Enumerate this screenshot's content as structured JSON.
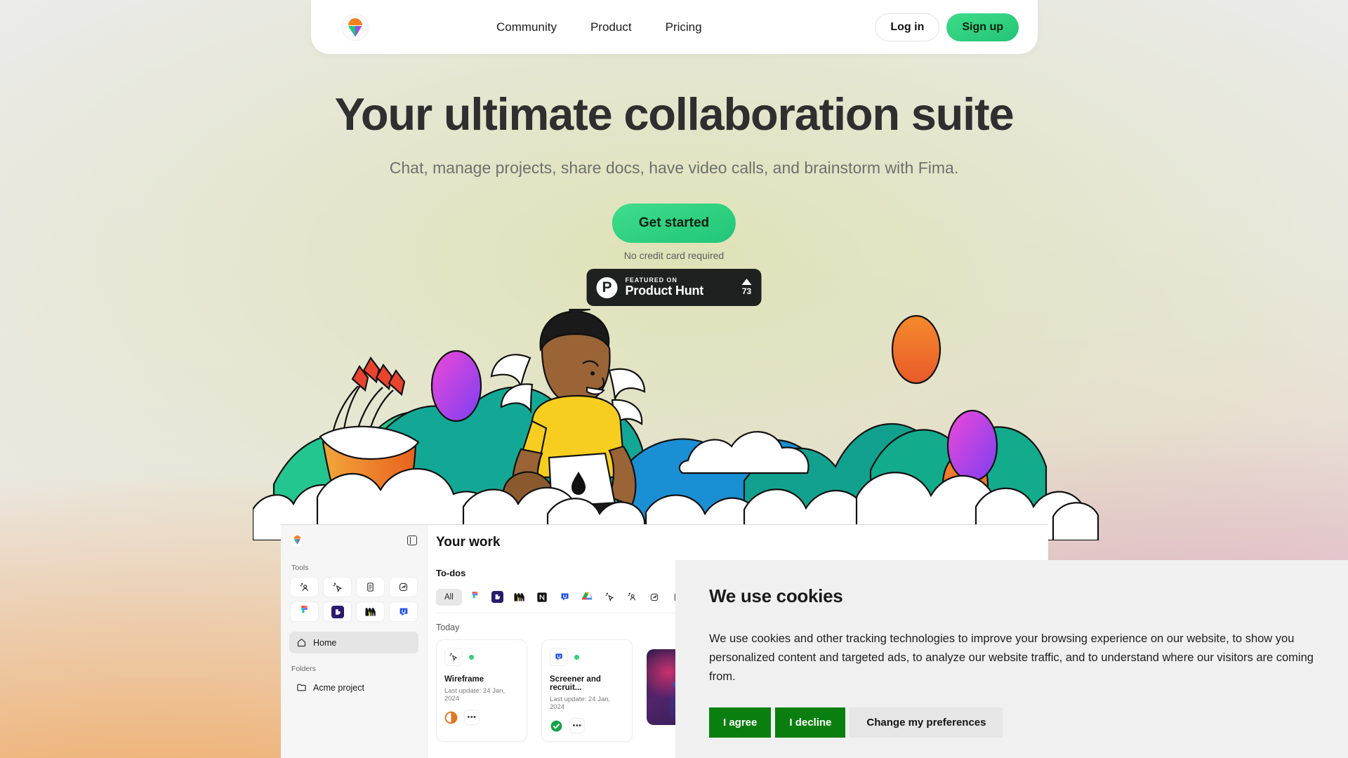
{
  "brand": {
    "logo_icon": "fima-triangle-circle-logo",
    "accent_green": "#2fcf7d",
    "accent_orange": "#f29c46",
    "accent_purple": "#9b4bdb"
  },
  "nav": {
    "links": [
      {
        "label": "Community",
        "name": "nav-link-community"
      },
      {
        "label": "Product",
        "name": "nav-link-product"
      },
      {
        "label": "Pricing",
        "name": "nav-link-pricing"
      }
    ],
    "login_label": "Log in",
    "signup_label": "Sign up"
  },
  "hero": {
    "title": "Your ultimate collaboration suite",
    "subtitle": "Chat, manage projects, share docs, have video calls, and brainstorm with Fima.",
    "cta_label": "Get started",
    "cta_note": "No credit card required",
    "illustration_name": "person-with-wings-on-laptop-in-clouds"
  },
  "product_hunt": {
    "featured_label": "FEATURED ON",
    "name": "Product Hunt",
    "upvotes": "73",
    "logo_glyph": "P"
  },
  "app_mockup": {
    "sidebar": {
      "logo_icon": "fima-logo-small",
      "collapse_icon": "sidebar-collapse-icon",
      "tools_label": "Tools",
      "tools": [
        {
          "name": "tool-meet-icon"
        },
        {
          "name": "tool-cursor-sparkle-icon"
        },
        {
          "name": "tool-docs-icon"
        },
        {
          "name": "tool-analytics-icon"
        },
        {
          "name": "tool-figma-icon"
        },
        {
          "name": "tool-dovetail-icon"
        },
        {
          "name": "tool-miro-icon"
        },
        {
          "name": "tool-usertesting-icon"
        }
      ],
      "home_label": "Home",
      "folders_label": "Folders",
      "folder_items": [
        {
          "label": "Acme project",
          "name": "folder-acme-project"
        }
      ]
    },
    "main": {
      "title": "Your work",
      "section_label": "To-dos",
      "filter_all_label": "All",
      "filters": [
        {
          "name": "filter-figma-icon"
        },
        {
          "name": "filter-dovetail-icon"
        },
        {
          "name": "filter-miro-icon"
        },
        {
          "name": "filter-notion-icon"
        },
        {
          "name": "filter-usertesting-icon"
        },
        {
          "name": "filter-google-drive-icon"
        },
        {
          "name": "filter-cursor-sparkle-icon"
        },
        {
          "name": "filter-meet-icon"
        },
        {
          "name": "filter-analytics-icon"
        },
        {
          "name": "filter-docs-icon"
        }
      ],
      "group_label": "Today",
      "cards": [
        {
          "title": "Wireframe",
          "meta": "Last update: 24 Jan, 2024",
          "app_icon": "cursor-sparkle-icon",
          "status_icon": "half-progress-icon",
          "more_label": "•••"
        },
        {
          "title": "Screener and recruit...",
          "meta": "Last update: 24 Jan, 2024",
          "app_icon": "usertesting-icon",
          "status_icon": "check-complete-icon",
          "more_label": "•••"
        }
      ]
    }
  },
  "cookie_banner": {
    "title": "We use cookies",
    "body": "We use cookies and other tracking technologies to improve your browsing experience on our website, to show you personalized content and targeted ads, to analyze our website traffic, and to understand where our visitors are coming from.",
    "agree_label": "I agree",
    "decline_label": "I decline",
    "preferences_label": "Change my preferences"
  }
}
